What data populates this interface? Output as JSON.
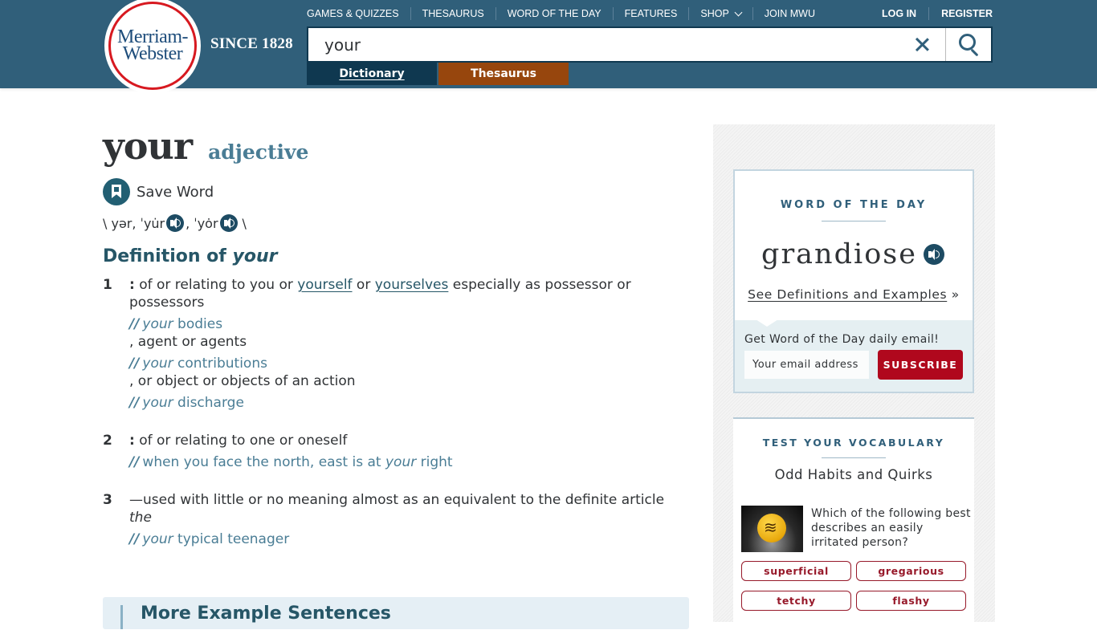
{
  "header": {
    "logo_line1": "Merriam-",
    "logo_line2": "Webster",
    "since": "SINCE 1828",
    "nav": [
      "GAMES & QUIZZES",
      "THESAURUS",
      "WORD OF THE DAY",
      "FEATURES",
      "SHOP",
      "JOIN MWU"
    ],
    "login": "LOG IN",
    "register": "REGISTER",
    "search_value": "your",
    "tabs": {
      "dictionary": "Dictionary",
      "thesaurus": "Thesaurus"
    }
  },
  "entry": {
    "headword": "your",
    "pos": "adjective",
    "save_label": "Save Word",
    "pron": {
      "open": "\\ yər, ˈyu̇r",
      "sep": ", ˈyȯr",
      "close": "\\"
    },
    "def_title_prefix": "Definition of ",
    "def_title_word": "your",
    "senses": [
      {
        "num": "1",
        "colon": ":",
        "text_a": " of or relating to you or ",
        "link1": "yourself",
        "text_b": " or ",
        "link2": "yourselves",
        "text_c": " especially as possessor or possessors",
        "examples": [
          {
            "slashes": "//",
            "em": "your",
            "rest": " bodies"
          },
          {
            "slashes": "//",
            "em": "your",
            "rest": " contributions"
          },
          {
            "slashes": "//",
            "em": "your",
            "rest": " discharge"
          }
        ],
        "subs": [
          ", agent or agents",
          ", or object or objects of an action"
        ]
      },
      {
        "num": "2",
        "colon": ":",
        "text": " of or relating to one or oneself",
        "example": {
          "slashes": "//",
          "pre": "when you face the north, east is at ",
          "em": "your",
          "rest": " right"
        }
      },
      {
        "num": "3",
        "text": "—used with little or no meaning almost as an equivalent to the definite article ",
        "em": "the",
        "example": {
          "slashes": "//",
          "em": "your",
          "rest": " typical teenager"
        }
      }
    ],
    "more_examples": "More Example Sentences"
  },
  "sidebar": {
    "wod": {
      "label": "WORD OF THE DAY",
      "word": "grandiose",
      "link": "See Definitions and Examples",
      "link_suffix": " »",
      "email_label": "Get Word of the Day daily email!",
      "email_placeholder": "Your email address",
      "subscribe": "SUBSCRIBE"
    },
    "vocab": {
      "label": "TEST YOUR VOCABULARY",
      "title": "Odd Habits and Quirks",
      "question": "Which of the following best describes an easily irritated person?",
      "answers": [
        "superficial",
        "gregarious",
        "tetchy",
        "flashy"
      ]
    }
  }
}
